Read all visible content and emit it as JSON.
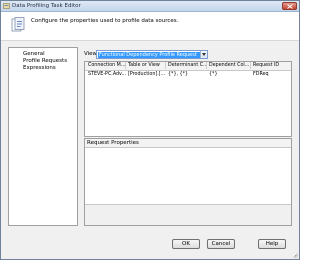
{
  "window": {
    "title": "Data Profiling Task Editor",
    "description": "Configure the properties used to profile data sources."
  },
  "nav": {
    "items": [
      {
        "label": "General"
      },
      {
        "label": "Profile Requests"
      },
      {
        "label": "Expressions"
      }
    ]
  },
  "view": {
    "label": "View",
    "selected": "Functional Dependency Profile Request"
  },
  "requests_grid": {
    "columns": [
      "Connection M...",
      "Table or View",
      "Determinant C...",
      "Dependent Col...",
      "Request ID"
    ],
    "rows": [
      [
        "STEVE-PC.Adv...",
        "[Production].[...",
        "{*}, {*}",
        "{*}",
        "FDReq"
      ]
    ]
  },
  "properties": {
    "header": "Request Properties"
  },
  "buttons": {
    "ok": "OK",
    "cancel": "Cancel",
    "help": "Help"
  },
  "colors": {
    "accent": "#3399ff",
    "dialog_bg": "#f0f0f0"
  }
}
